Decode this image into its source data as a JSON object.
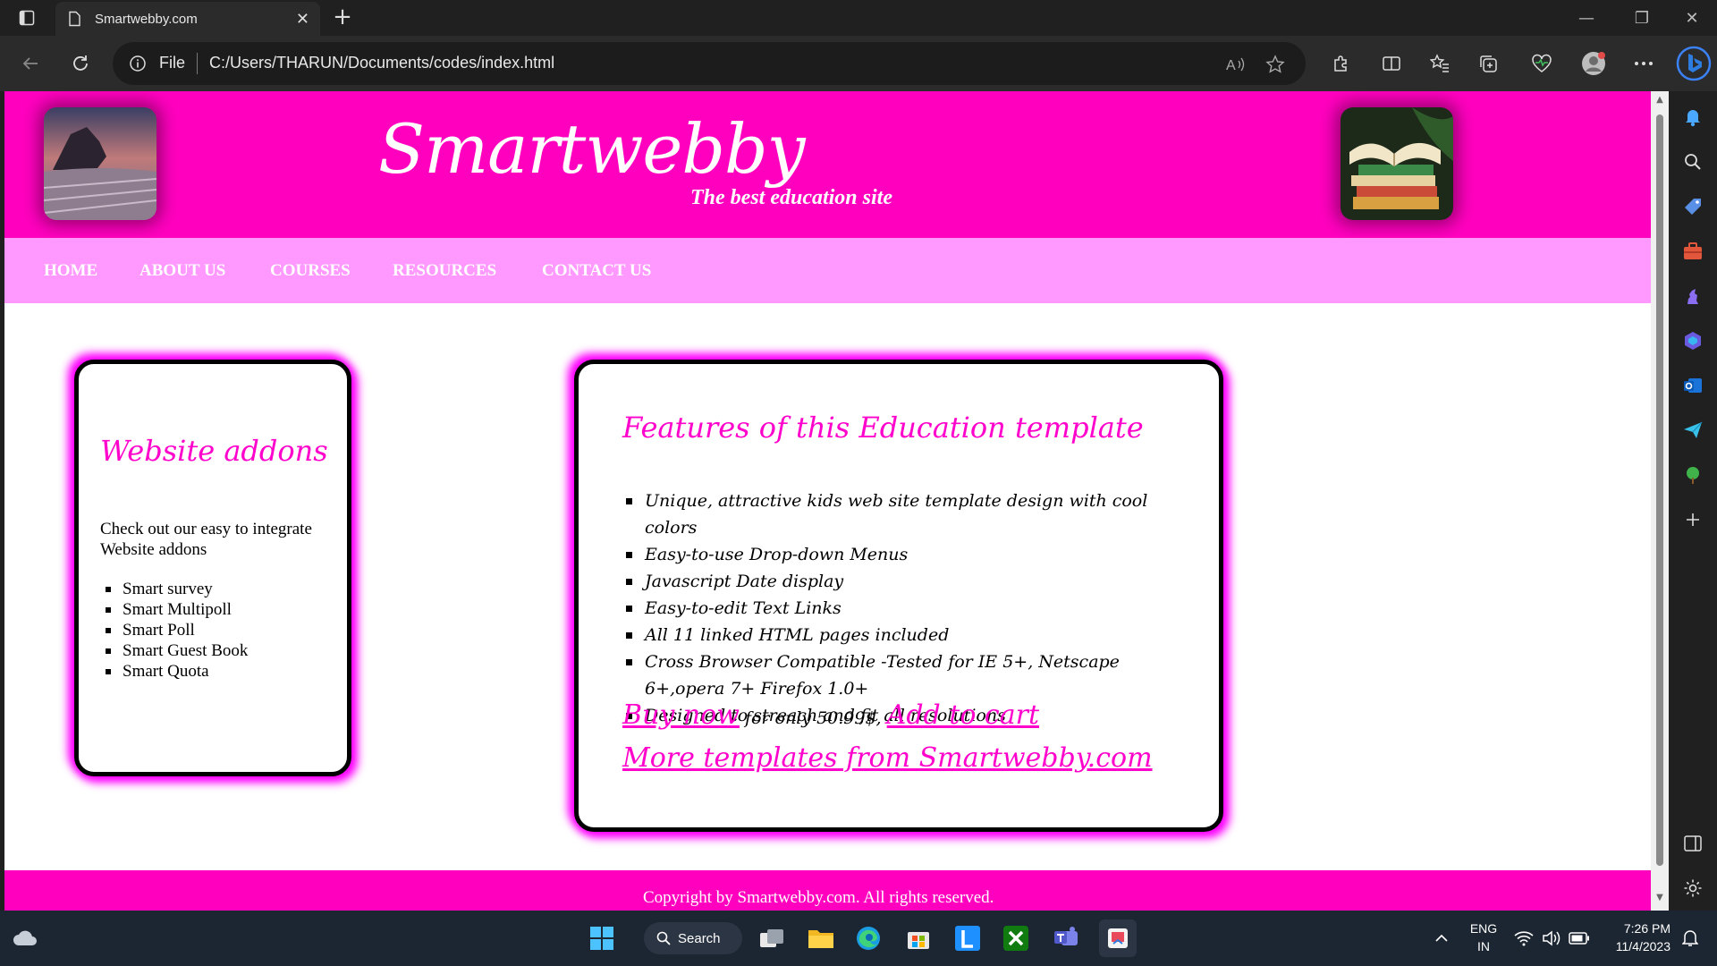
{
  "browser": {
    "tab_title": "Smartwebby.com",
    "address_scheme": "File",
    "address_url": "C:/Users/THARUN/Documents/codes/index.html"
  },
  "site": {
    "title": "Smartwebby",
    "tagline": "The best education site",
    "nav": [
      "HOME",
      "ABOUT US",
      "COURSES",
      "RESOURCES",
      "CONTACT US"
    ],
    "addons": {
      "title": "Website addons",
      "description": "Check out our easy to integrate Website addons",
      "items": [
        "Smart survey",
        "Smart Multipoll",
        "Smart Poll",
        "Smart Guest Book",
        "Smart Quota"
      ]
    },
    "features": {
      "title": "Features of this Education template",
      "items": [
        "Unique, attractive kids web site template design with cool colors",
        "Easy-to-use Drop-down Menus",
        "Javascript Date display",
        "Easy-to-edit Text Links",
        "All 11 linked HTML pages included",
        "Cross Browser Compatible -Tested for IE 5+, Netscape 6+,opera 7+ Firefox 1.0+",
        "Designed to streach and fit all resolutions"
      ],
      "buy_now": "Buy now",
      "price_text": " for only 50.99$, ",
      "add_to_cart": "Add to cart",
      "more_templates": "More templates from Smartwebby.com"
    },
    "footer": "Copyright by Smartwebby.com. All rights reserved."
  },
  "taskbar": {
    "search_label": "Search",
    "lang_top": "ENG",
    "lang_bottom": "IN",
    "time": "7:26 PM",
    "date": "11/4/2023"
  },
  "colors": {
    "brand_pink": "#ff00bf",
    "nav_pink": "#ff99ff",
    "heading_pink": "#ff00cc"
  }
}
